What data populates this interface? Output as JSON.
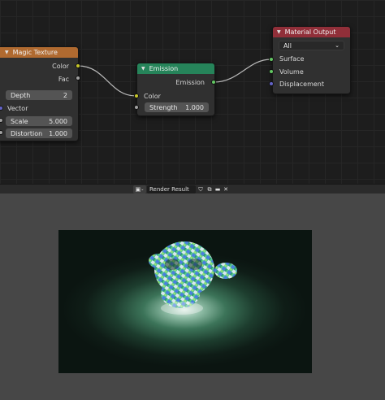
{
  "magic_texture": {
    "title": "Magic Texture",
    "outputs": [
      "Color",
      "Fac"
    ],
    "depth_label": "Depth",
    "depth_value": "2",
    "vector_label": "Vector",
    "scale_label": "Scale",
    "scale_value": "5.000",
    "distortion_label": "Distortion",
    "distortion_value": "1.000",
    "header_color": "#b06a30"
  },
  "emission": {
    "title": "Emission",
    "output_label": "Emission",
    "color_label": "Color",
    "strength_label": "Strength",
    "strength_value": "1.000",
    "header_color": "#26845a"
  },
  "material_output": {
    "title": "Material Output",
    "target": "All",
    "inputs": [
      "Surface",
      "Volume",
      "Displacement"
    ],
    "header_color": "#912f39"
  },
  "image_editor": {
    "image_name": "Render Result"
  },
  "colors": {
    "socket_color": "#c7c729",
    "socket_float": "#a1a1a1",
    "socket_vector": "#6363c7",
    "socket_shader": "#63c763",
    "wire": "#b9b9b9"
  }
}
